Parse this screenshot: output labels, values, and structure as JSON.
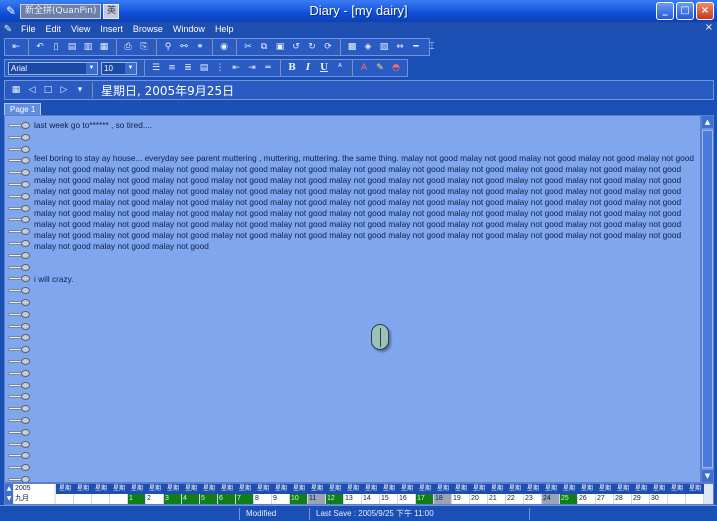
{
  "window": {
    "title": "Diary - [my dairy]",
    "ime_name": "新全拼(QuanPin)",
    "ime_button": "英",
    "controls": [
      "_",
      "□",
      "×"
    ]
  },
  "menu": {
    "items": [
      "File",
      "Edit",
      "View",
      "Insert",
      "Browse",
      "Window",
      "Help"
    ],
    "doc_close": "×"
  },
  "format": {
    "font_name": "Arial",
    "font_size": "10"
  },
  "date_bar": {
    "date": "星期日, 2005年9月25日"
  },
  "tabs": [
    "Page 1"
  ],
  "entry": {
    "line1": "last week go to****** , so tired....",
    "paragraph2": "feel boring to stay ay house... everyday see parent muttering , muttering, muttering. the same thing. malay not good malay not good malay not good malay not good malay not good malay not good malay not good malay not good malay not good malay not good malay not good malay not good malay not good malay not good malay not good malay not good malay not good malay not good malay not good malay not good malay not good malay not good malay not good malay not good malay not good malay not good malay not good malay not good malay not good malay not good malay not good malay not good malay not good malay not good malay not good malay not good malay not good malay not good malay not good malay not good malay not good malay not good malay not good malay not good malay not good malay not good malay not good malay not good malay not good malay not good malay not good malay not good malay not good malay not good malay not good malay not good malay not good malay not good malay not good malay not good malay not good malay not good malay not good malay not good malay not good malay not good malay not good malay not good malay not good malay not good malay not good malay not good malay not good malay not good malay not good malay not good malay not good malay not good malay not good malay not good malay not good malay not good malay not good malay not good malay not good",
    "line3": "i will crazy."
  },
  "calendar": {
    "year": "2005",
    "month": "九月",
    "weekday_label": "星期",
    "days": [
      {
        "n": "",
        "s": ""
      },
      {
        "n": "",
        "s": ""
      },
      {
        "n": "",
        "s": ""
      },
      {
        "n": "",
        "s": ""
      },
      {
        "n": "1",
        "s": "hit"
      },
      {
        "n": "2",
        "s": ""
      },
      {
        "n": "3",
        "s": "hit"
      },
      {
        "n": "4",
        "s": "hit"
      },
      {
        "n": "5",
        "s": "hit"
      },
      {
        "n": "6",
        "s": "hit"
      },
      {
        "n": "7",
        "s": "hit"
      },
      {
        "n": "8",
        "s": ""
      },
      {
        "n": "9",
        "s": ""
      },
      {
        "n": "10",
        "s": "hit"
      },
      {
        "n": "11",
        "s": "dim"
      },
      {
        "n": "12",
        "s": "hit"
      },
      {
        "n": "13",
        "s": ""
      },
      {
        "n": "14",
        "s": ""
      },
      {
        "n": "15",
        "s": ""
      },
      {
        "n": "16",
        "s": ""
      },
      {
        "n": "17",
        "s": "hit"
      },
      {
        "n": "18",
        "s": "dim"
      },
      {
        "n": "19",
        "s": ""
      },
      {
        "n": "20",
        "s": ""
      },
      {
        "n": "21",
        "s": ""
      },
      {
        "n": "22",
        "s": ""
      },
      {
        "n": "23",
        "s": ""
      },
      {
        "n": "24",
        "s": "dim"
      },
      {
        "n": "25",
        "s": "hit"
      },
      {
        "n": "26",
        "s": ""
      },
      {
        "n": "27",
        "s": ""
      },
      {
        "n": "28",
        "s": ""
      },
      {
        "n": "29",
        "s": ""
      },
      {
        "n": "30",
        "s": ""
      },
      {
        "n": "",
        "s": ""
      },
      {
        "n": "",
        "s": ""
      }
    ]
  },
  "status": {
    "modified": "Modified",
    "last_save": "Last Save : 2005/9/25 下午 11:00"
  },
  "colors": {
    "title_gradient_top": "#3b7cf5",
    "page_background": "#80a7ee",
    "marked_day": "#0f7d18"
  }
}
